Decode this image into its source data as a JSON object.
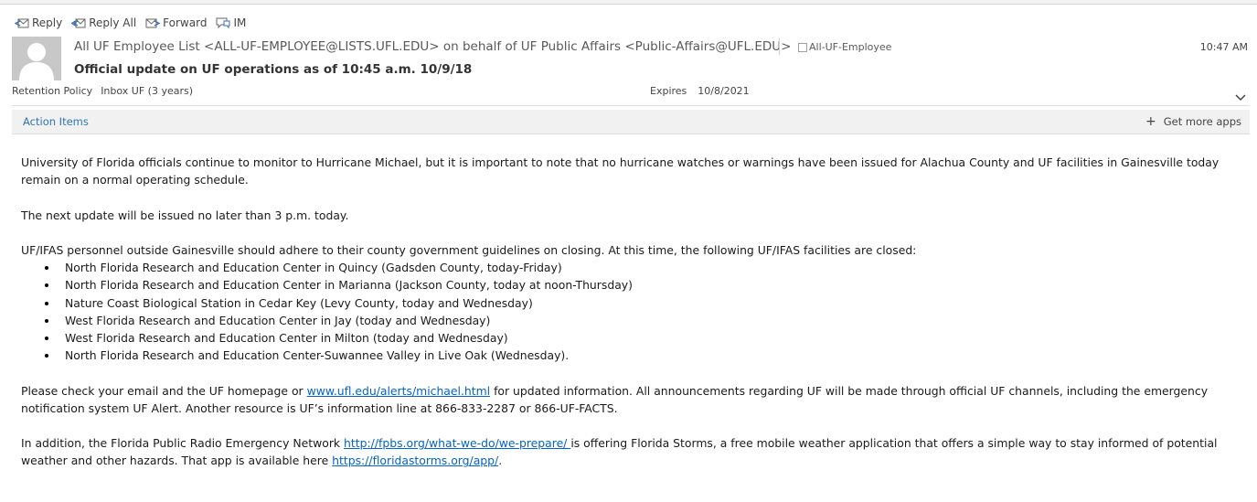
{
  "toolbar": {
    "reply": "Reply",
    "reply_all": "Reply All",
    "forward": "Forward",
    "im": "IM"
  },
  "header": {
    "from": "All UF Employee List <ALL-UF-EMPLOYEE@LISTS.UFL.EDU> on behalf of UF Public Affairs <Public-Affairs@UFL.EDU>",
    "category": "All-UF-Employee",
    "time": "10:47 AM",
    "subject": "Official update on UF operations as of 10:45 a.m. 10/9/18",
    "retention_label": "Retention Policy",
    "retention_value": "Inbox UF (3 years)",
    "expires_label": "Expires",
    "expires_value": "10/8/2021"
  },
  "actionbar": {
    "action_items": "Action Items",
    "get_more_apps": "Get more apps"
  },
  "body": {
    "p1": "University of Florida officials continue to monitor to Hurricane Michael, but it is important to note that no hurricane watches or warnings have been issued for Alachua County and UF facilities in Gainesville today remain on a normal operating schedule.",
    "p2": "The next update will be issued no later than 3 p.m. today.",
    "p3": "UF/IFAS personnel outside Gainesville should adhere to their county government guidelines on closing. At this time, the following UF/IFAS facilities are closed:",
    "closures": [
      "North Florida Research and Education Center in Quincy (Gadsden County, today-Friday)",
      "North Florida Research and Education Center in Marianna (Jackson County, today at noon-Thursday)",
      "Nature Coast Biological Station in Cedar Key (Levy County, today and Wednesday)",
      "West Florida Research and Education Center in Jay (today and Wednesday)",
      "West Florida Research and Education Center in Milton (today and Wednesday)",
      "North Florida Research and Education Center-Suwannee Valley in Live Oak (Wednesday)."
    ],
    "p4_a": "Please check your email and the UF homepage or ",
    "p4_link": "www.ufl.edu/alerts/michael.html",
    "p4_b": " for updated information. All announcements regarding UF will be made through official UF channels, including the emergency notification system UF Alert. Another resource is UF’s information line at 866-833-2287 or 866-UF-FACTS.",
    "p5_a": "In addition, the Florida Public Radio Emergency Network ",
    "p5_link1": "http://fpbs.org/what-we-do/we-prepare/ ",
    "p5_b": "is offering Florida Storms, a free mobile weather application that offers a simple way to stay informed of potential weather and other hazards. That app is available here ",
    "p5_link2": "https://floridastorms.org/app/",
    "p5_c": "."
  }
}
